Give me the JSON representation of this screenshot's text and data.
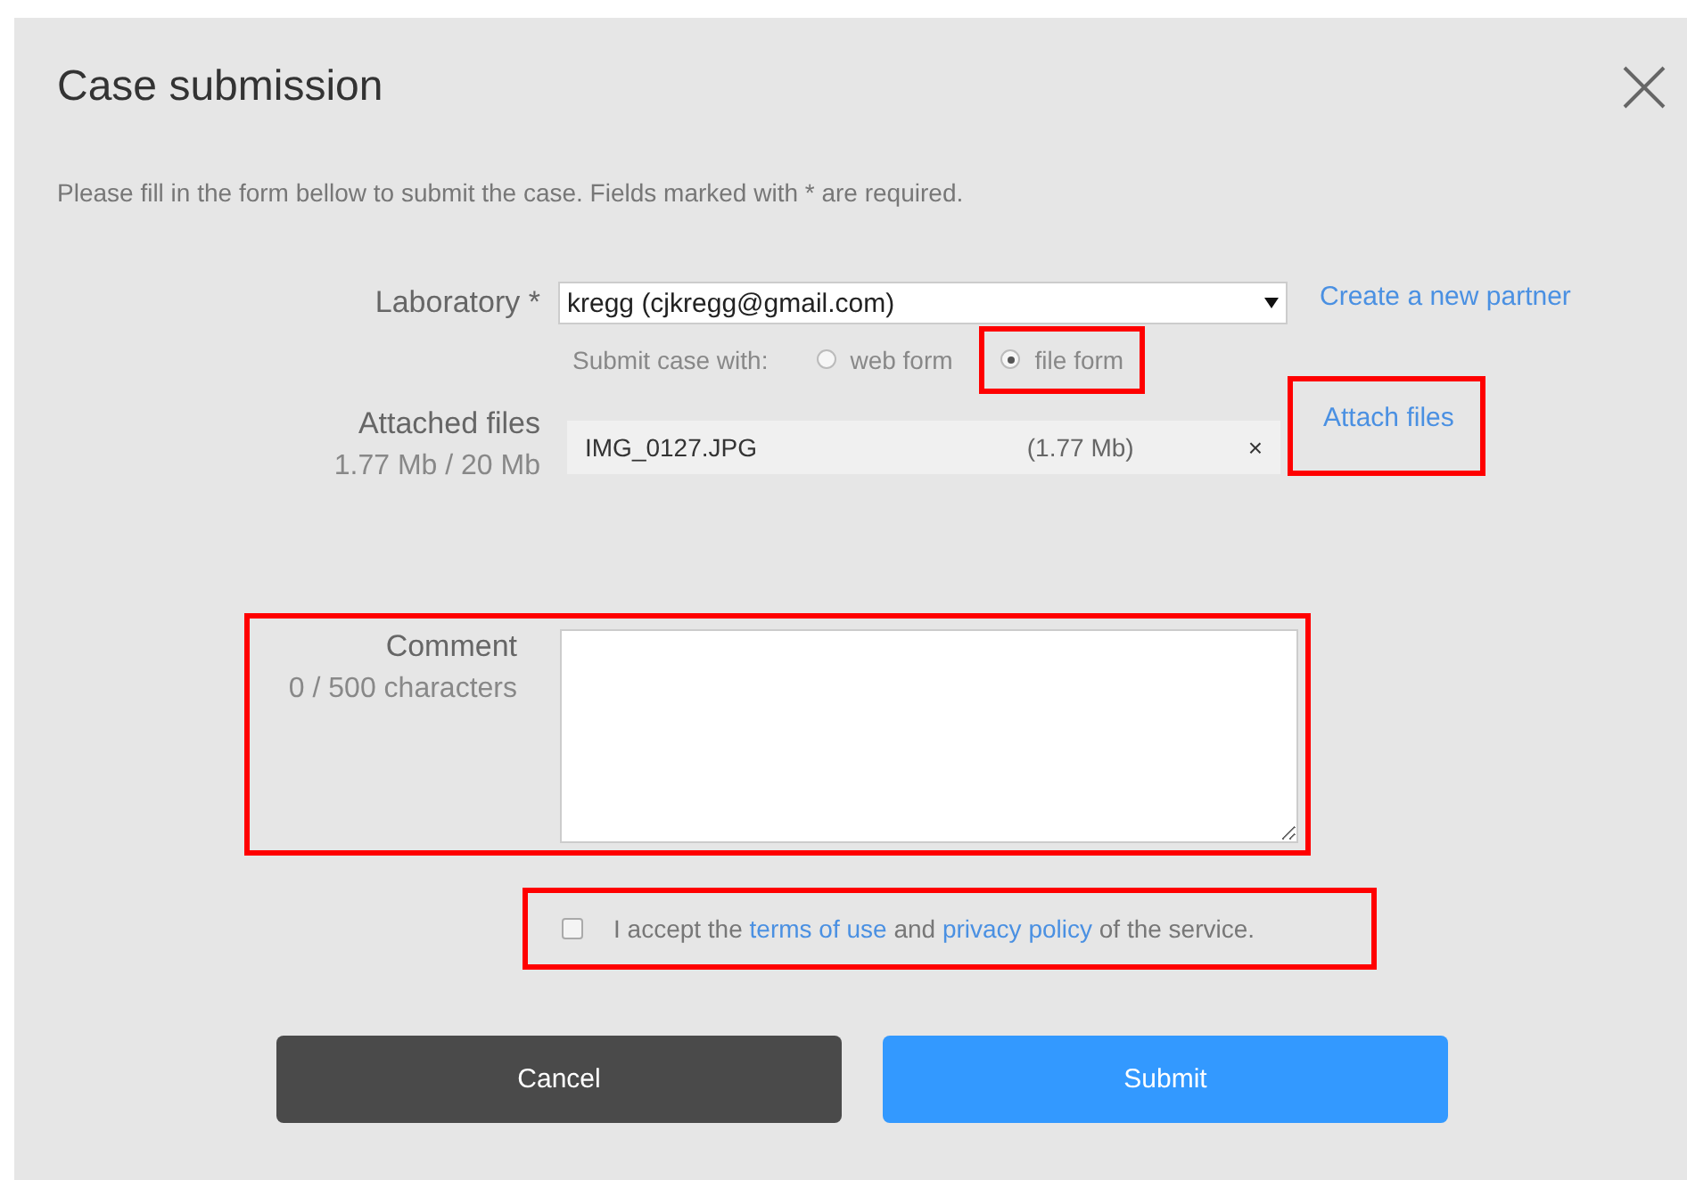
{
  "dialog": {
    "title": "Case submission",
    "intro": "Please fill in the form bellow to submit the case. Fields marked with * are required."
  },
  "laboratory": {
    "label": "Laboratory *",
    "value": "kregg (cjkregg@gmail.com)",
    "link": "Create a new partner"
  },
  "submit_with": {
    "label": "Submit case with:",
    "options": [
      {
        "label": "web form",
        "selected": false,
        "highlighted": false
      },
      {
        "label": "file form",
        "selected": true,
        "highlighted": true
      }
    ]
  },
  "attachments": {
    "label": "Attached files",
    "usage": "1.77 Mb / 20 Mb",
    "files": [
      {
        "name": "IMG_0127.JPG",
        "size": "(1.77 Mb)",
        "remove": "×"
      }
    ],
    "link": {
      "label": "Attach files",
      "highlighted": true
    }
  },
  "comment": {
    "label": "Comment",
    "counter": "0 / 500 characters",
    "highlighted": true
  },
  "terms": {
    "checked": false,
    "highlighted": true,
    "parts": [
      {
        "kind": "text",
        "text": "I accept the"
      },
      {
        "kind": "link",
        "text": "terms of use"
      },
      {
        "kind": "text",
        "text": "and"
      },
      {
        "kind": "link",
        "text": "privacy policy"
      },
      {
        "kind": "text",
        "text": "of the service."
      }
    ]
  },
  "buttons": [
    {
      "label": "Cancel",
      "kind": "secondary"
    },
    {
      "label": "Submit",
      "kind": "primary"
    }
  ]
}
